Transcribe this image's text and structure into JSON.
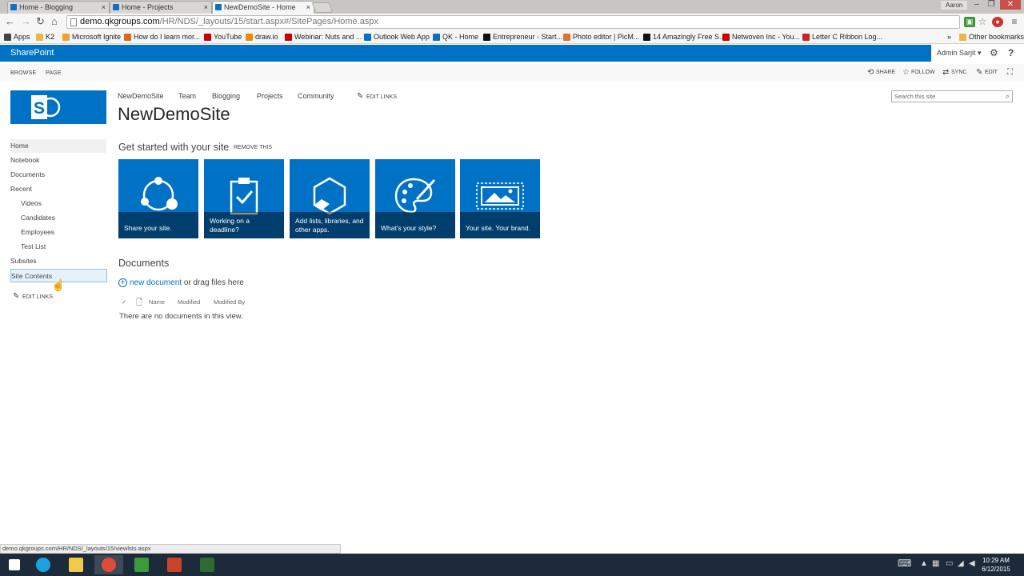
{
  "browser": {
    "tabs": [
      {
        "label": "Home - Blogging",
        "active": false
      },
      {
        "label": "Home - Projects",
        "active": false
      },
      {
        "label": "NewDemoSite - Home",
        "active": true
      }
    ],
    "close_glyph": "×",
    "profile": "Aaron",
    "url_host": "demo.qkgroups.com",
    "url_path": "/HR/NDS/_layouts/15/start.aspx#/SitePages/Home.aspx",
    "bookmarks": [
      {
        "label": "Apps",
        "color": "#444444"
      },
      {
        "label": "K2",
        "color": "#e8b84a"
      },
      {
        "label": "Microsoft Ignite",
        "color": "#f0a030"
      },
      {
        "label": "How do I learn mor...",
        "color": "#d86b1b"
      },
      {
        "label": "YouTube",
        "color": "#cc0000"
      },
      {
        "label": "draw.io",
        "color": "#f08705"
      },
      {
        "label": "Webinar: Nuts and ...",
        "color": "#cc0000"
      },
      {
        "label": "Outlook Web App",
        "color": "#0072c6"
      },
      {
        "label": "QK - Home",
        "color": "#0f6fc6"
      },
      {
        "label": "Entrepreneur - Start...",
        "color": "#111111"
      },
      {
        "label": "Photo editor | PicM...",
        "color": "#e07030"
      },
      {
        "label": "14 Amazingly Free S...",
        "color": "#111111"
      },
      {
        "label": "Netwoven Inc - You...",
        "color": "#cc0000"
      },
      {
        "label": "Letter C Ribbon Log...",
        "color": "#cc2222"
      }
    ],
    "more_bookmarks": "»",
    "other_bookmarks": "Other bookmarks",
    "status_url": "demo.qkgroups.com/HR/NDS/_layouts/15/viewlsts.aspx"
  },
  "suite": {
    "brand": "SharePoint",
    "user": "Admin Sarjit ▾",
    "settings_glyph": "⚙",
    "help_glyph": "?"
  },
  "ribbon": {
    "tabs": [
      "BROWSE",
      "PAGE"
    ],
    "actions": [
      "SHARE",
      "FOLLOW",
      "SYNC",
      "EDIT"
    ]
  },
  "site": {
    "title": "NewDemoSite",
    "top_nav": [
      "NewDemoSite",
      "Team",
      "Blogging",
      "Projects",
      "Community"
    ],
    "edit_links": "EDIT LINKS",
    "search_placeholder": "Search this site",
    "left_nav": [
      {
        "label": "Home",
        "level": 0,
        "state": "selected"
      },
      {
        "label": "Notebook",
        "level": 0,
        "state": ""
      },
      {
        "label": "Documents",
        "level": 0,
        "state": ""
      },
      {
        "label": "Recent",
        "level": 0,
        "state": ""
      },
      {
        "label": "Videos",
        "level": 1,
        "state": ""
      },
      {
        "label": "Candidates",
        "level": 1,
        "state": ""
      },
      {
        "label": "Employees",
        "level": 1,
        "state": ""
      },
      {
        "label": "Test List",
        "level": 1,
        "state": ""
      },
      {
        "label": "Subsites",
        "level": 0,
        "state": ""
      },
      {
        "label": "Site Contents",
        "level": 0,
        "state": "hover"
      }
    ],
    "left_edit_links": "EDIT LINKS"
  },
  "get_started": {
    "title": "Get started with your site",
    "remove": "REMOVE THIS",
    "tiles": [
      {
        "label": "Share your site.",
        "icon": "share-icon"
      },
      {
        "label": "Working on a deadline?",
        "icon": "clipboard-check-icon"
      },
      {
        "label": "Add lists, libraries, and other apps.",
        "icon": "hexagon-icon"
      },
      {
        "label": "What's your style?",
        "icon": "palette-icon"
      },
      {
        "label": "Your site. Your brand.",
        "icon": "image-icon"
      }
    ]
  },
  "documents": {
    "title": "Documents",
    "new_document": "new document",
    "drag_text": " or drag files here",
    "columns": [
      "Name",
      "Modified",
      "Modified By"
    ],
    "empty": "There are no documents in this view."
  },
  "taskbar": {
    "time": "10:29 AM",
    "date": "6/12/2015",
    "apps": [
      {
        "name": "start-button",
        "color": "#ffffff"
      },
      {
        "name": "internet-explorer",
        "color": "#1ea1e1"
      },
      {
        "name": "file-explorer",
        "color": "#f2c94c"
      },
      {
        "name": "chrome",
        "color": "#e04a3a"
      },
      {
        "name": "camtasia-green",
        "color": "#3b9a3b"
      },
      {
        "name": "powerpoint",
        "color": "#c8452c"
      },
      {
        "name": "camtasia",
        "color": "#2f6b2f"
      }
    ]
  },
  "colors": {
    "sharepoint_blue": "#0072c6",
    "accent_link": "#0072c6"
  }
}
